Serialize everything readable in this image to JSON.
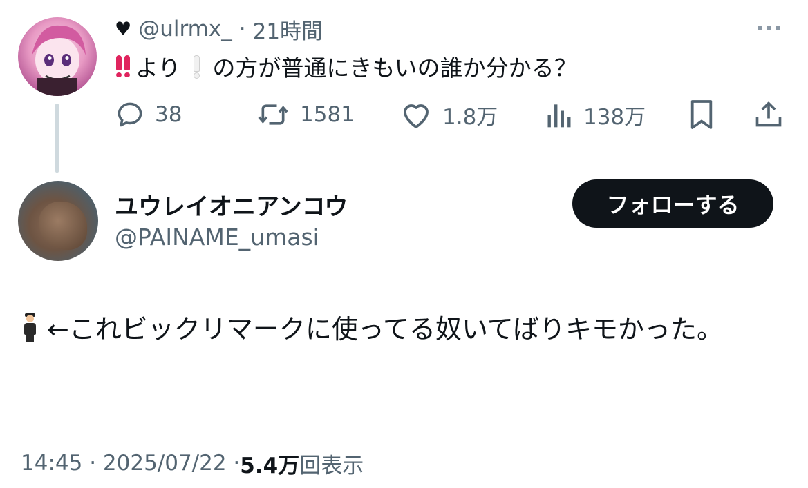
{
  "parent_tweet": {
    "handle": "@ulrmx_",
    "separator": "·",
    "time_ago": "21時間",
    "text_part1": "より",
    "text_part2": "の方が普通にきもいの誰か分かる？",
    "actions": {
      "replies": "38",
      "reposts": "1581",
      "likes": "1.8万",
      "views": "138万"
    }
  },
  "main_tweet": {
    "display_name": "ユウレイオニアンコウ",
    "handle": "@PAINAME_umasi",
    "follow_label": "フォローする",
    "text": "←これビックリマークに使ってる奴いてばりキモかった。",
    "timestamp": "14:45 · 2025/07/22 · ",
    "views_count": "5.4万",
    "views_label": "回表示"
  },
  "icons": {
    "heart": "black-heart-icon",
    "double_exclamation": "double-exclamation-icon",
    "white_exclamation": "white-exclamation-icon",
    "man_in_suit": "man-levitating-icon"
  },
  "colors": {
    "text_primary": "#0f1419",
    "text_secondary": "#536471",
    "follow_bg": "#0f1419",
    "emoji_red": "#e0245e"
  }
}
